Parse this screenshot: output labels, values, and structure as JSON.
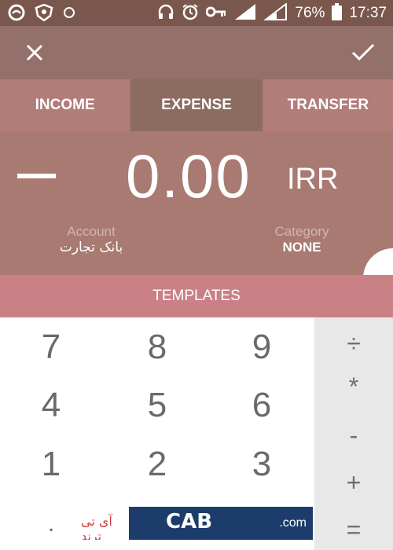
{
  "status_bar": {
    "battery": "76%",
    "time": "17:37",
    "sim1": "1",
    "sim2": "2"
  },
  "toolbar": {
    "close_icon": "close-icon",
    "confirm_icon": "check-icon"
  },
  "tabs": [
    {
      "label": "INCOME",
      "active": false
    },
    {
      "label": "EXPENSE",
      "active": true
    },
    {
      "label": "TRANSFER",
      "active": false
    }
  ],
  "amount": {
    "sign": "−",
    "value": "0.00",
    "currency": "IRR"
  },
  "account": {
    "label": "Account",
    "value": "بانک تجارت"
  },
  "category": {
    "label": "Category",
    "value": "NONE"
  },
  "templates_label": "TEMPLATES",
  "keypad": {
    "digits": [
      "7",
      "8",
      "9",
      "4",
      "5",
      "6",
      "1",
      "2",
      "3"
    ],
    "bottom_left": "."
  },
  "operators": [
    "÷",
    "*",
    "-",
    "+",
    "="
  ],
  "banner": {
    "fa_text": "آی تی ترند",
    "logo": "CAB",
    "domain": ".com"
  },
  "colors": {
    "status_bar": "#7a574d",
    "toolbar": "#94706a",
    "tabs": "#b27c78",
    "tab_active": "#8c6b61",
    "amount_panel": "#a97a72",
    "templates": "#c98186",
    "ops_panel": "#e8e8e8"
  }
}
